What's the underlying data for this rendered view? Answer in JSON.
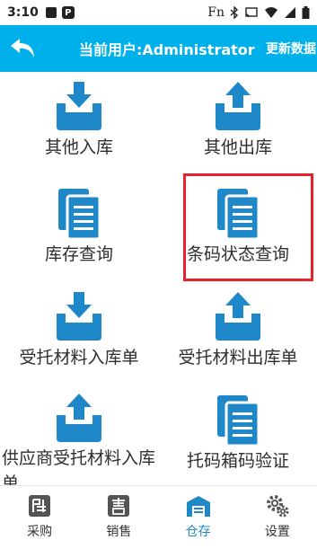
{
  "status_bar": {
    "time": "3:10",
    "fn_label": "Fn"
  },
  "app_bar": {
    "title": "当前用户:Administrator",
    "sync_label": "更新数据"
  },
  "menu": {
    "items": [
      {
        "label": "其他入库",
        "icon": "tray-arrow-down-icon"
      },
      {
        "label": "其他出库",
        "icon": "tray-arrow-up-icon"
      },
      {
        "label": "库存查询",
        "icon": "document-icon"
      },
      {
        "label": "条码状态查询",
        "icon": "document-icon"
      },
      {
        "label": "受托材料入库单",
        "icon": "tray-arrow-down-icon"
      },
      {
        "label": "受托材料出库单",
        "icon": "tray-arrow-up-icon"
      },
      {
        "label": "供应商受托材料入库单",
        "icon": "tray-arrow-up-icon"
      },
      {
        "label": "托码箱码验证",
        "icon": "document-icon"
      }
    ]
  },
  "bottom_nav": {
    "items": [
      {
        "label": "采购",
        "icon": "purchase-icon"
      },
      {
        "label": "销售",
        "icon": "sales-icon"
      },
      {
        "label": "仓存",
        "icon": "warehouse-icon",
        "active": true
      },
      {
        "label": "设置",
        "icon": "gear-icon"
      }
    ]
  },
  "colors": {
    "primary": "#00b0ea",
    "icon_blue": "#1e88c9",
    "highlight_red": "#e8202a"
  }
}
